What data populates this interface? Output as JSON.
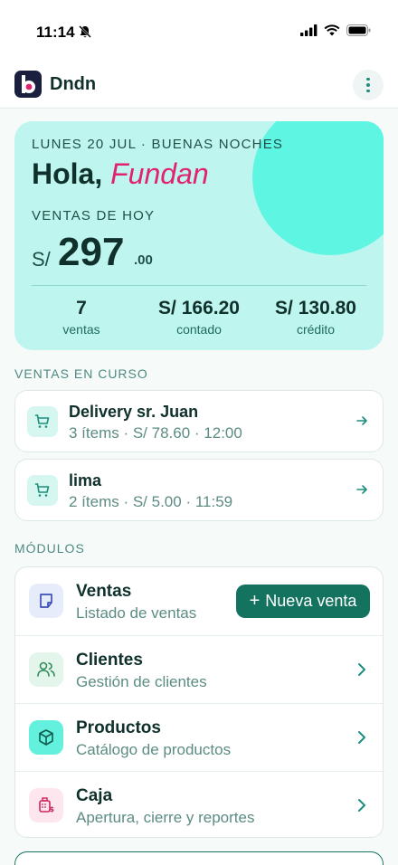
{
  "status_bar": {
    "time": "11:14"
  },
  "app": {
    "title": "Dndn",
    "logo_letter": "b"
  },
  "hero": {
    "date_line": "LUNES 20 JUL · BUENAS NOCHES",
    "greeting": "Hola,",
    "name": "Fundan",
    "sales_label": "VENTAS DE HOY",
    "currency": "S/",
    "amount": "297",
    "cents": ".00",
    "stats": [
      {
        "value": "7",
        "label": "ventas"
      },
      {
        "value": "S/ 166.20",
        "label": "contado"
      },
      {
        "value": "S/ 130.80",
        "label": "crédito"
      }
    ]
  },
  "in_progress": {
    "title": "VENTAS EN CURSO",
    "items": [
      {
        "name": "Delivery sr. Juan",
        "details": "3 ítems · S/ 78.60 · 12:00"
      },
      {
        "name": "lima",
        "details": "2 ítems · S/ 5.00 · 11:59"
      }
    ]
  },
  "modules": {
    "title": "MÓDULOS",
    "items": [
      {
        "name": "Ventas",
        "description": "Listado de ventas",
        "icon": "sticky-note-icon"
      },
      {
        "name": "Clientes",
        "description": "Gestión de clientes",
        "icon": "users-icon"
      },
      {
        "name": "Productos",
        "description": "Catálogo de productos",
        "icon": "box-icon"
      },
      {
        "name": "Caja",
        "description": "Apertura, cierre y reportes",
        "icon": "cash-register-icon"
      }
    ],
    "new_sale_button": "Nueva venta"
  },
  "colors": {
    "accent": "#14735f",
    "hero_bg": "#bff5ef",
    "hero_circle": "#5ef5e3",
    "name_pink": "#e0226f"
  }
}
